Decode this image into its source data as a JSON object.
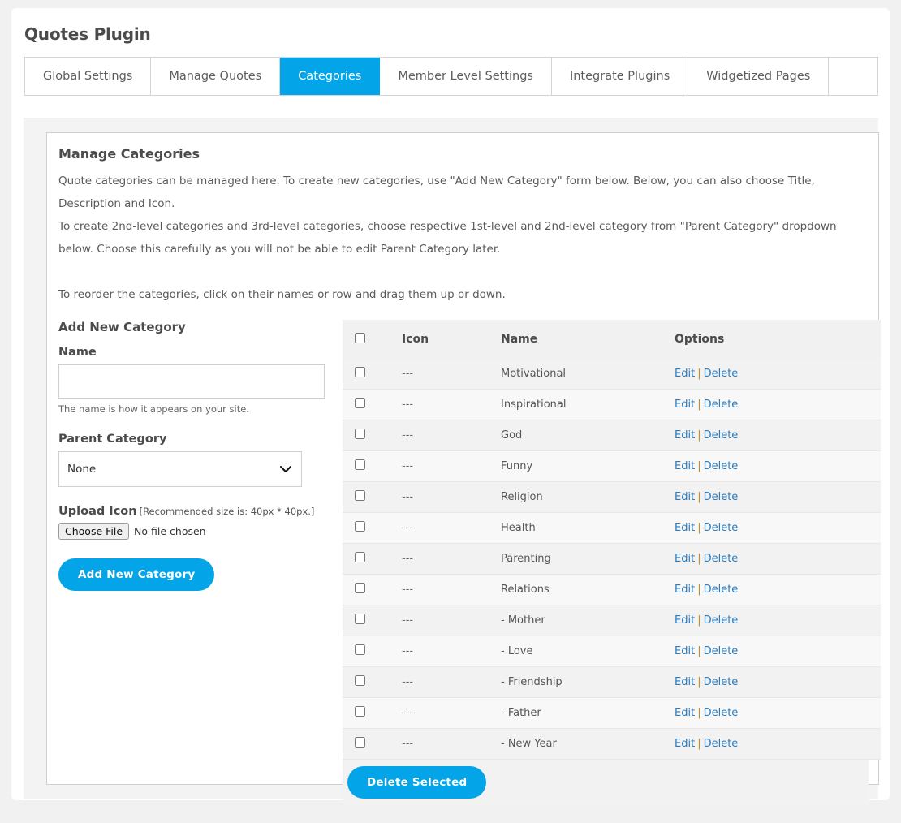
{
  "page": {
    "title": "Quotes Plugin"
  },
  "tabs": [
    {
      "label": "Global Settings",
      "active": false
    },
    {
      "label": "Manage Quotes",
      "active": false
    },
    {
      "label": "Categories",
      "active": true
    },
    {
      "label": "Member Level Settings",
      "active": false
    },
    {
      "label": "Integrate Plugins",
      "active": false
    },
    {
      "label": "Widgetized Pages",
      "active": false
    }
  ],
  "panel": {
    "section_title": "Manage Categories",
    "intro_1": "Quote categories can be managed here. To create new categories, use \"Add New Category\" form below. Below, you can also choose Title, Description and Icon.",
    "intro_2": "To create 2nd-level categories and 3rd-level categories, choose respective 1st-level and 2nd-level category from \"Parent Category\" dropdown below. Choose this carefully as you will not be able to edit Parent Category later.",
    "intro_3": "To reorder the categories, click on their names or row and drag them up or down."
  },
  "form": {
    "heading": "Add New Category",
    "name_label": "Name",
    "name_value": "",
    "name_placeholder": "",
    "name_help": "The name is how it appears on your site.",
    "parent_label": "Parent Category",
    "parent_selected": "None",
    "parent_options": [
      "None"
    ],
    "upload_label": "Upload Icon",
    "upload_hint": "[Recommended size is: 40px * 40px.]",
    "choose_file_label": "Choose File",
    "file_status": "No file chosen",
    "submit_label": "Add New Category"
  },
  "table": {
    "headers": {
      "select_all": "",
      "icon": "Icon",
      "name": "Name",
      "options": "Options"
    },
    "edit_label": "Edit",
    "separator": "|",
    "delete_label": "Delete",
    "icon_placeholder": "---",
    "rows": [
      {
        "icon": "---",
        "name": "Motivational"
      },
      {
        "icon": "---",
        "name": "Inspirational"
      },
      {
        "icon": "---",
        "name": "God"
      },
      {
        "icon": "---",
        "name": "Funny"
      },
      {
        "icon": "---",
        "name": "Religion"
      },
      {
        "icon": "---",
        "name": "Health"
      },
      {
        "icon": "---",
        "name": "Parenting"
      },
      {
        "icon": "---",
        "name": "Relations"
      },
      {
        "icon": "---",
        "name": "- Mother"
      },
      {
        "icon": "---",
        "name": "- Love"
      },
      {
        "icon": "---",
        "name": "- Friendship"
      },
      {
        "icon": "---",
        "name": "- Father"
      },
      {
        "icon": "---",
        "name": "- New Year"
      }
    ],
    "delete_selected_label": "Delete Selected"
  },
  "colors": {
    "accent_blue": "#04a4e8",
    "link_blue": "#2a7bbd",
    "page_bg": "#f1f1f1",
    "row_odd": "#f2f2f2",
    "row_even": "#f8f8f8",
    "heading_text": "#4b4b4b"
  }
}
